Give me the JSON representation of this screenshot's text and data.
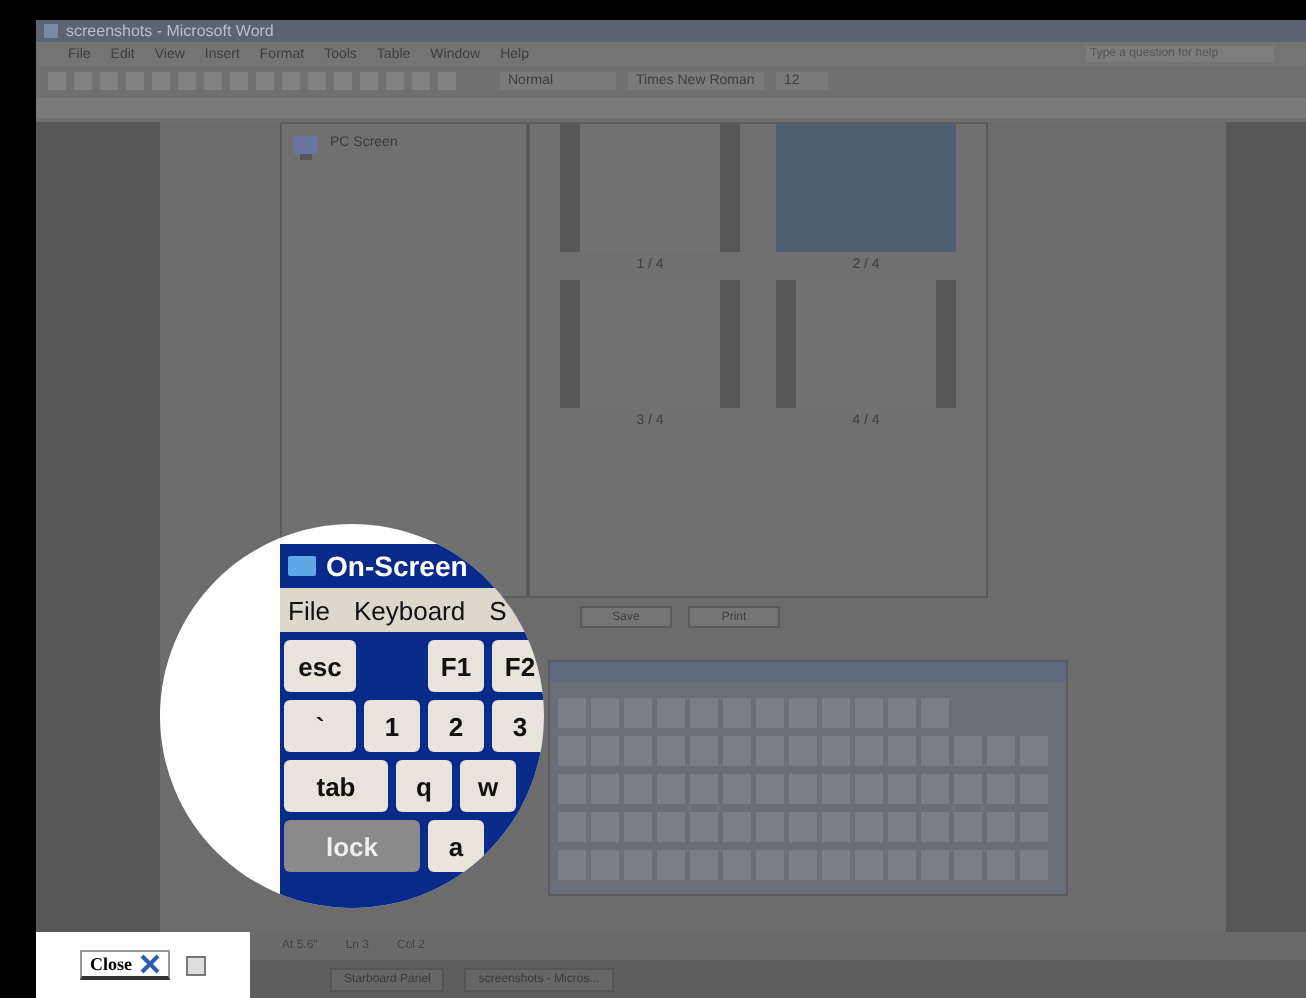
{
  "window": {
    "title": "screenshots - Microsoft Word"
  },
  "menu": [
    "File",
    "Edit",
    "View",
    "Insert",
    "Format",
    "Tools",
    "Table",
    "Window",
    "Help"
  ],
  "help_box": {
    "placeholder": "Type a question for help"
  },
  "toolbar": {
    "style": "Normal",
    "font": "Times New Roman",
    "size": "12"
  },
  "task_pane": {
    "item": "PC Screen",
    "thumbnails": [
      {
        "label": "1 / 4",
        "selected": false
      },
      {
        "label": "2 / 4",
        "selected": true
      },
      {
        "label": "3 / 4",
        "selected": false
      },
      {
        "label": "4 / 4",
        "selected": false
      }
    ],
    "buttons": [
      "Save",
      "Print"
    ]
  },
  "magnifier": {
    "title": "On-Screen",
    "menu": [
      "File",
      "Keyboard",
      "S"
    ],
    "function_keys": [
      {
        "label": "esc",
        "on": false
      },
      {
        "kind": "gap"
      },
      {
        "label": "F1",
        "on": false
      },
      {
        "label": "F2",
        "on": false
      }
    ],
    "number_keys": [
      {
        "label": "`",
        "on": false
      },
      {
        "label": "1",
        "on": false
      },
      {
        "label": "2",
        "on": false
      },
      {
        "label": "3",
        "on": false
      }
    ],
    "upper_letter_keys": [
      {
        "label": "tab",
        "on": false
      },
      {
        "label": "q",
        "on": false
      },
      {
        "label": "w",
        "on": false
      }
    ],
    "home_keys": [
      {
        "label": "lock",
        "on": true
      },
      {
        "label": "a",
        "on": false
      }
    ]
  },
  "close_button": "Close",
  "status_bar": [
    "At 5.6\"",
    "Ln 3",
    "Col 2"
  ],
  "taskbar": [
    "Starboard Panel",
    "screenshots - Micros..."
  ]
}
